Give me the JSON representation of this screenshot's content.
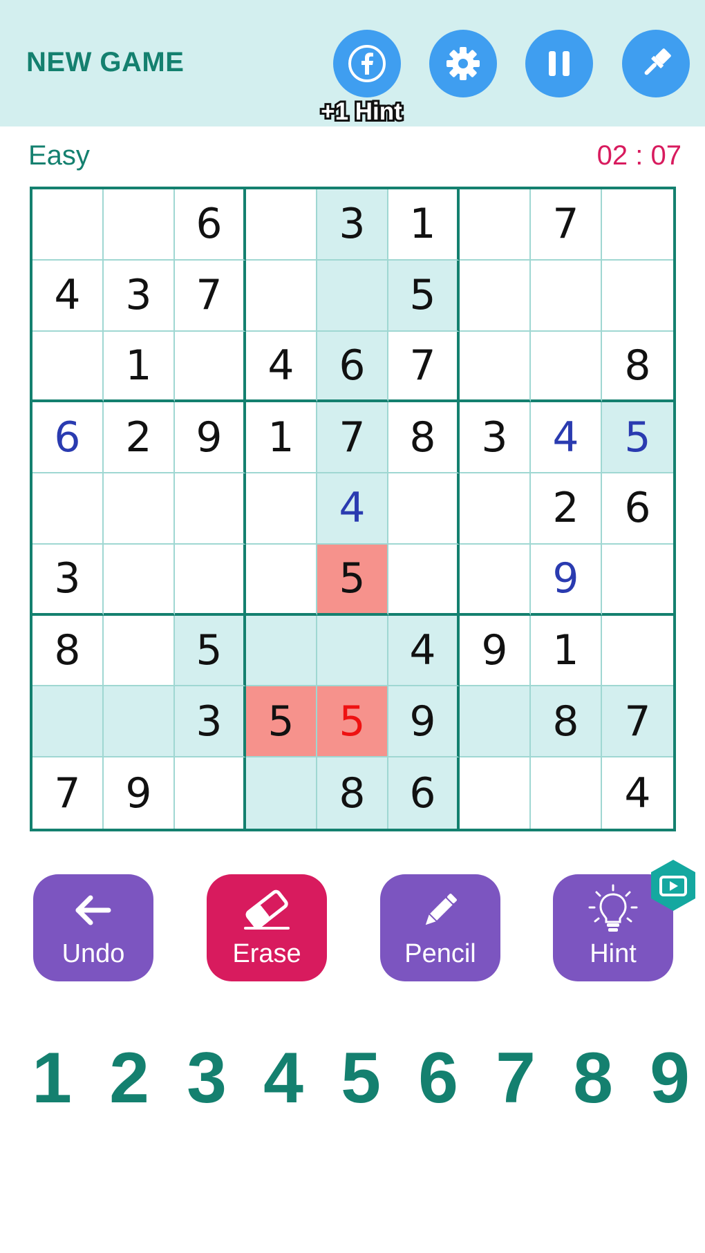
{
  "header": {
    "new_game_label": "NEW GAME",
    "hint_badge": "+1 Hint",
    "button_color": "#3f9ef0",
    "background": "#d3efef",
    "buttons": [
      {
        "icon": "facebook-icon"
      },
      {
        "icon": "gear-icon"
      },
      {
        "icon": "pause-icon"
      },
      {
        "icon": "paint-brush-icon"
      }
    ]
  },
  "status": {
    "difficulty": "Easy",
    "timer": "02 : 07"
  },
  "board": {
    "cells": [
      [
        "",
        "",
        "6",
        "",
        "3",
        "1",
        "",
        "7",
        ""
      ],
      [
        "4",
        "3",
        "7",
        "",
        "",
        "5",
        "",
        "",
        ""
      ],
      [
        "",
        "1",
        "",
        "4",
        "6",
        "7",
        "",
        "",
        "8"
      ],
      [
        "6",
        "2",
        "9",
        "1",
        "7",
        "8",
        "3",
        "4",
        "5"
      ],
      [
        "",
        "",
        "",
        "",
        "4",
        "",
        "",
        "2",
        "6"
      ],
      [
        "3",
        "",
        "",
        "",
        "5",
        "",
        "",
        "9",
        ""
      ],
      [
        "8",
        "",
        "5",
        "",
        "",
        "4",
        "9",
        "1",
        ""
      ],
      [
        "",
        "",
        "3",
        "5",
        "5",
        "9",
        "",
        "8",
        "7"
      ],
      [
        "7",
        "9",
        "",
        "",
        "8",
        "6",
        "",
        "",
        "4"
      ]
    ],
    "user_entries": [
      "3-0",
      "3-7",
      "3-8",
      "4-4",
      "5-7",
      "7-4"
    ],
    "highlighted": [
      "0-4",
      "1-4",
      "1-5",
      "2-4",
      "3-4",
      "3-8",
      "4-4",
      "6-2",
      "6-3",
      "6-4",
      "6-5",
      "7-0",
      "7-1",
      "7-2",
      "7-5",
      "7-6",
      "7-7",
      "7-8",
      "8-3",
      "8-4",
      "8-5"
    ],
    "conflicts": [
      "5-4",
      "7-3",
      "7-4"
    ],
    "wrong_entries": [
      "7-4"
    ],
    "colors": {
      "border": "#14806f",
      "highlight": "#d3efef",
      "conflict": "#f6928c",
      "user_digit": "#2a3bb0",
      "wrong_digit": "#ee1111"
    }
  },
  "actions": [
    {
      "label": "Undo",
      "icon": "undo-arrow-icon"
    },
    {
      "label": "Erase",
      "icon": "eraser-icon"
    },
    {
      "label": "Pencil",
      "icon": "pencil-icon"
    },
    {
      "label": "Hint",
      "icon": "lightbulb-icon"
    }
  ],
  "action_colors": {
    "primary": "#7c55c0",
    "erase": "#d81b5e",
    "video_badge": "#14a8a0"
  },
  "numpad": [
    "1",
    "2",
    "3",
    "4",
    "5",
    "6",
    "7",
    "8",
    "9"
  ]
}
